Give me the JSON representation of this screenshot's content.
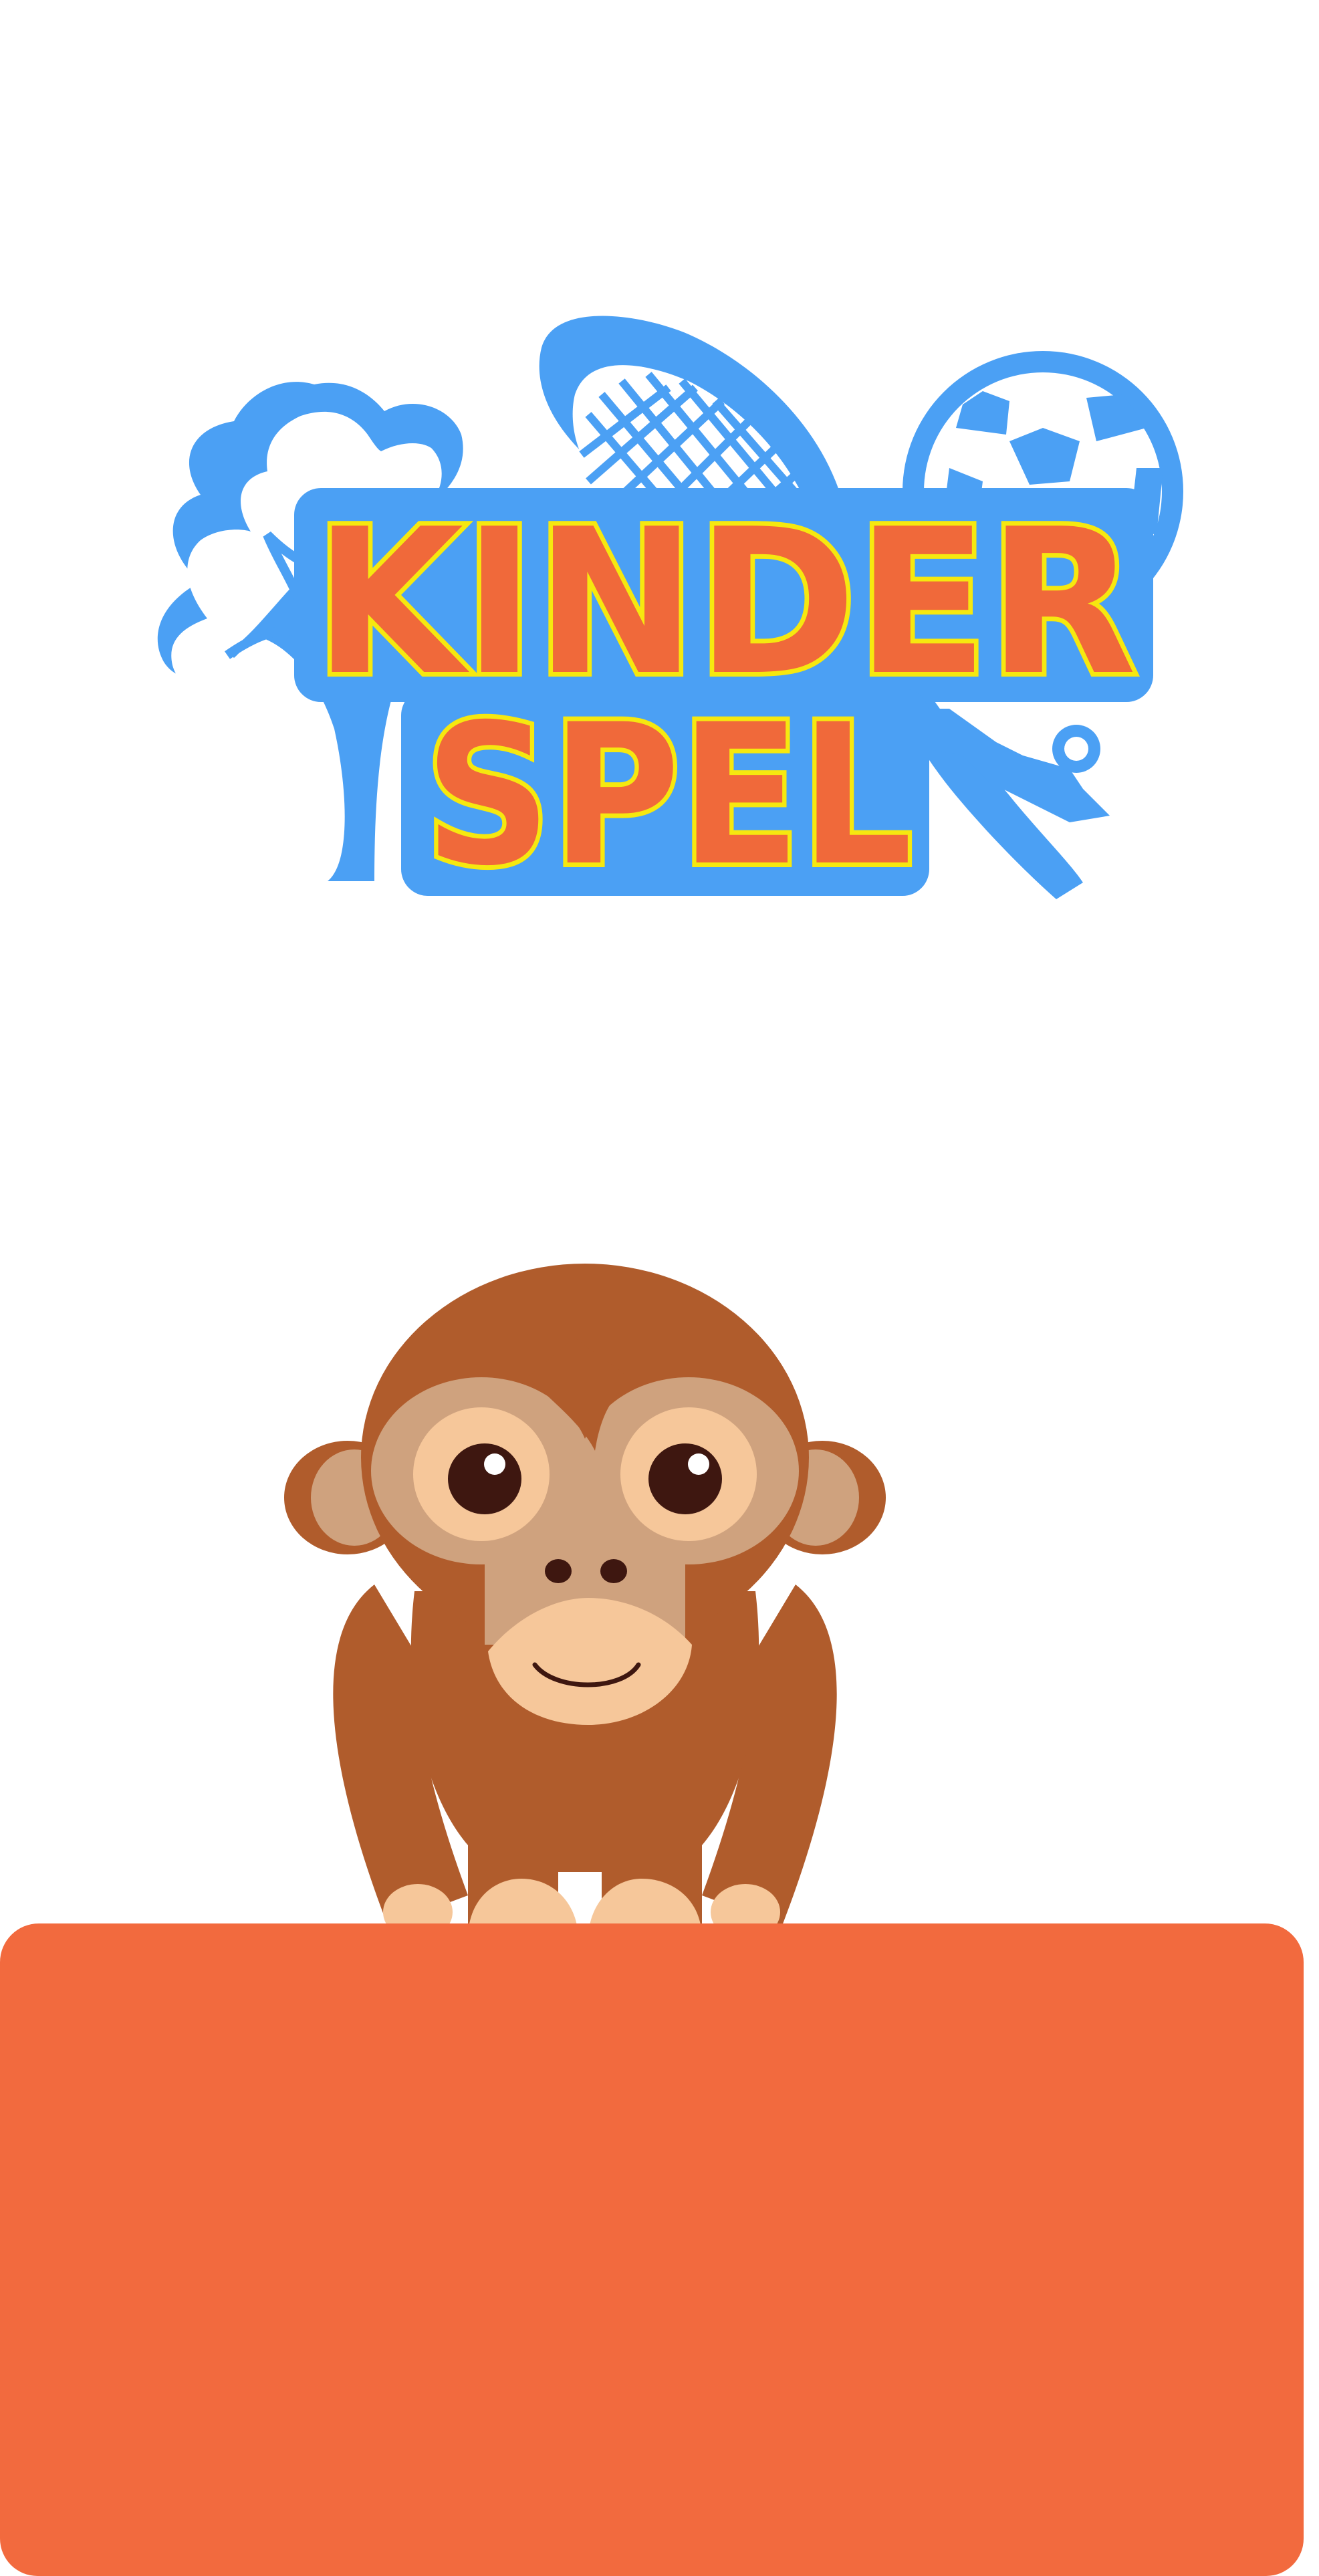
{
  "logo": {
    "word1": "KINDER",
    "word2": "SPEL"
  },
  "colors": {
    "logo_outline": "#4ba0f4",
    "logo_stroke": "#f6e80f",
    "logo_fill": "#f0693a",
    "monkey_fur": "#b05c2c",
    "monkey_face": "#cfa27e",
    "monkey_skin": "#f6c79a",
    "monkey_eye": "#3e1710",
    "panel": "#f26a3e"
  },
  "icons": [
    "tree-icon",
    "tennis-racket-icon",
    "soccer-ball-icon",
    "whistle-icon"
  ]
}
